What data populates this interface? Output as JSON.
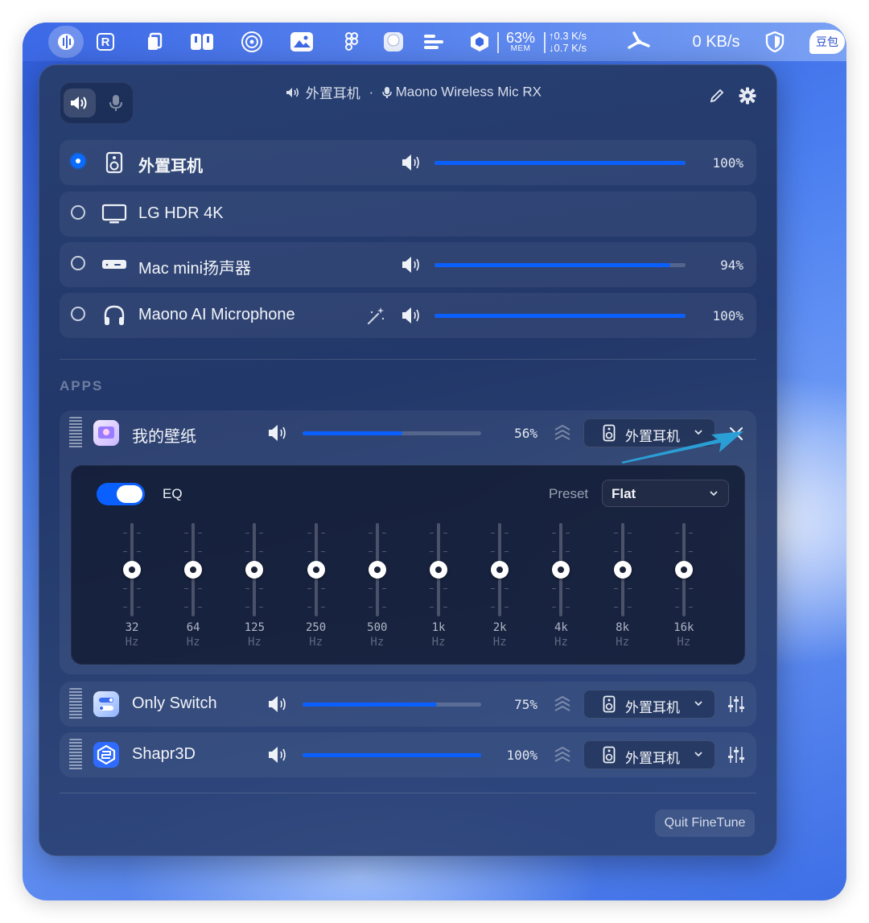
{
  "menubar": {
    "app_icon": "finetune-app-icon",
    "mem_percent": "63%",
    "mem_label": "MEM",
    "net_up": "↑0.3 K/s",
    "net_down": "↓0.7 K/s",
    "kbs": "0 KB/s",
    "doubao_label": "豆包"
  },
  "header": {
    "output_device": "外置耳机",
    "separator": "·",
    "input_device": "Maono Wireless Mic RX"
  },
  "devices": [
    {
      "name": "外置耳机",
      "icon": "speaker-box-icon",
      "selected": true,
      "volume": 100,
      "volume_label": "100%"
    },
    {
      "name": "LG HDR 4K",
      "icon": "monitor-icon",
      "selected": false
    },
    {
      "name": "Mac mini扬声器",
      "icon": "mac-mini-icon",
      "selected": false,
      "volume": 94,
      "volume_label": "94%"
    },
    {
      "name": "Maono AI Microphone",
      "icon": "headphones-icon",
      "selected": false,
      "volume": 100,
      "volume_label": "100%"
    }
  ],
  "apps_section_label": "APPS",
  "apps": [
    {
      "name": "我的壁纸",
      "volume": 56,
      "volume_label": "56%",
      "route": "外置耳机",
      "icon_color": "#c8b6ff"
    },
    {
      "name": "Only Switch",
      "volume": 75,
      "volume_label": "75%",
      "route": "外置耳机",
      "icon_color": "#4f8dff"
    },
    {
      "name": "Shapr3D",
      "volume": 100,
      "volume_label": "100%",
      "route": "外置耳机",
      "icon_color": "#2f6bff"
    }
  ],
  "eq": {
    "label": "EQ",
    "enabled": true,
    "preset_label": "Preset",
    "preset_value": "Flat",
    "bands": [
      {
        "freq": "32",
        "unit": "Hz",
        "gain": 0
      },
      {
        "freq": "64",
        "unit": "Hz",
        "gain": 0
      },
      {
        "freq": "125",
        "unit": "Hz",
        "gain": 0
      },
      {
        "freq": "250",
        "unit": "Hz",
        "gain": 0
      },
      {
        "freq": "500",
        "unit": "Hz",
        "gain": 0
      },
      {
        "freq": "1k",
        "unit": "Hz",
        "gain": 0
      },
      {
        "freq": "2k",
        "unit": "Hz",
        "gain": 0
      },
      {
        "freq": "4k",
        "unit": "Hz",
        "gain": 0
      },
      {
        "freq": "8k",
        "unit": "Hz",
        "gain": 0
      },
      {
        "freq": "16k",
        "unit": "Hz",
        "gain": 0
      }
    ]
  },
  "quit_label": "Quit FineTune",
  "colors": {
    "accent": "#0a60ff",
    "annotation_arrow": "#2a9fd6"
  }
}
